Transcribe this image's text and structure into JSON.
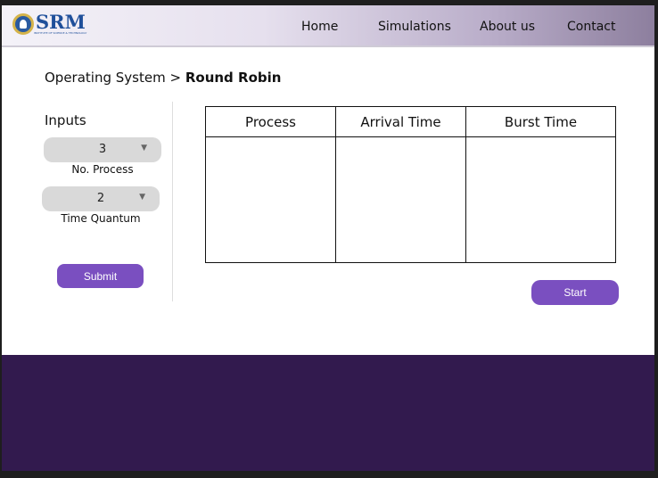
{
  "header": {
    "logo_text": "SRM",
    "logo_subtext": "INSTITUTE OF SCIENCE & TECHNOLOGY",
    "nav": [
      "Home",
      "Simulations",
      "About us",
      "Contact"
    ]
  },
  "breadcrumb": {
    "parent": "Operating System",
    "separator": ">",
    "current": "Round Robin"
  },
  "inputs": {
    "title": "Inputs",
    "processes": {
      "value": "3",
      "label": "No. Process"
    },
    "quantum": {
      "value": "2",
      "label": "Time Quantum"
    },
    "submit": "Submit"
  },
  "table": {
    "headers": [
      "Process",
      "Arrival Time",
      "Burst Time"
    ]
  },
  "start": "Start",
  "icons": {
    "dropdown": "caret-down-icon"
  },
  "colors": {
    "accent": "#7a4fc0",
    "footer": "#321a4e"
  }
}
